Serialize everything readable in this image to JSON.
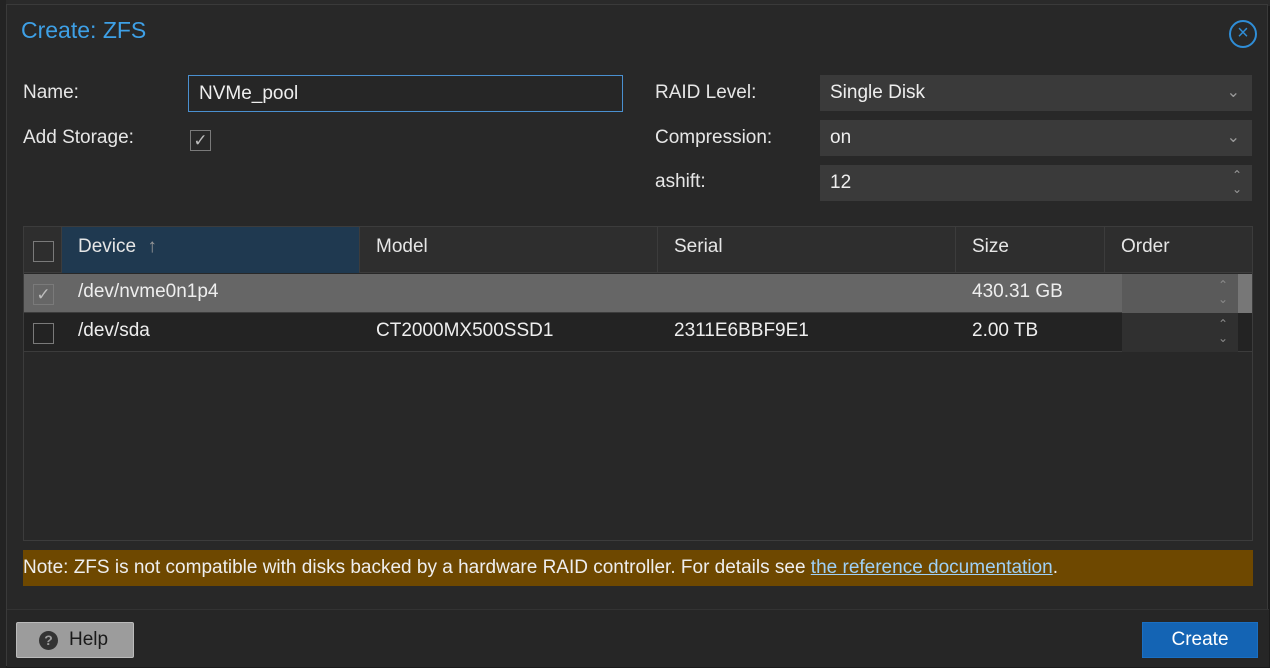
{
  "dialog": {
    "title": "Create: ZFS",
    "close_icon": "×"
  },
  "form": {
    "name_label": "Name:",
    "name_value": "NVMe_pool",
    "add_storage_label": "Add Storage:",
    "add_storage_checked": true,
    "raid_label": "RAID Level:",
    "raid_value": "Single Disk",
    "compression_label": "Compression:",
    "compression_value": "on",
    "ashift_label": "ashift:",
    "ashift_value": "12"
  },
  "grid": {
    "columns": [
      "Device",
      "Model",
      "Serial",
      "Size",
      "Order"
    ],
    "sort_arrow": "↑",
    "rows": [
      {
        "device": "/dev/nvme0n1p4",
        "model": "",
        "serial": "",
        "size": "430.31 GB",
        "order": "",
        "selected": true
      },
      {
        "device": "/dev/sda",
        "model": "CT2000MX500SSD1",
        "serial": "2311E6BBF9E1",
        "size": "2.00 TB",
        "order": "",
        "selected": false
      }
    ]
  },
  "note": {
    "text": "Note: ZFS is not compatible with disks backed by a hardware RAID controller. For details see ",
    "link": "the reference documentation",
    "suffix": "."
  },
  "footer": {
    "help_label": "Help",
    "create_label": "Create"
  },
  "icons": {
    "check": "✓",
    "dropdown": "⌄",
    "spinner_up": "⌃",
    "spinner_down": "⌄",
    "help": "?"
  },
  "colors": {
    "accent": "#3ea0e6",
    "primary_button": "#1464b4",
    "warning_bg": "#6e4800",
    "selected_row": "#666666"
  }
}
